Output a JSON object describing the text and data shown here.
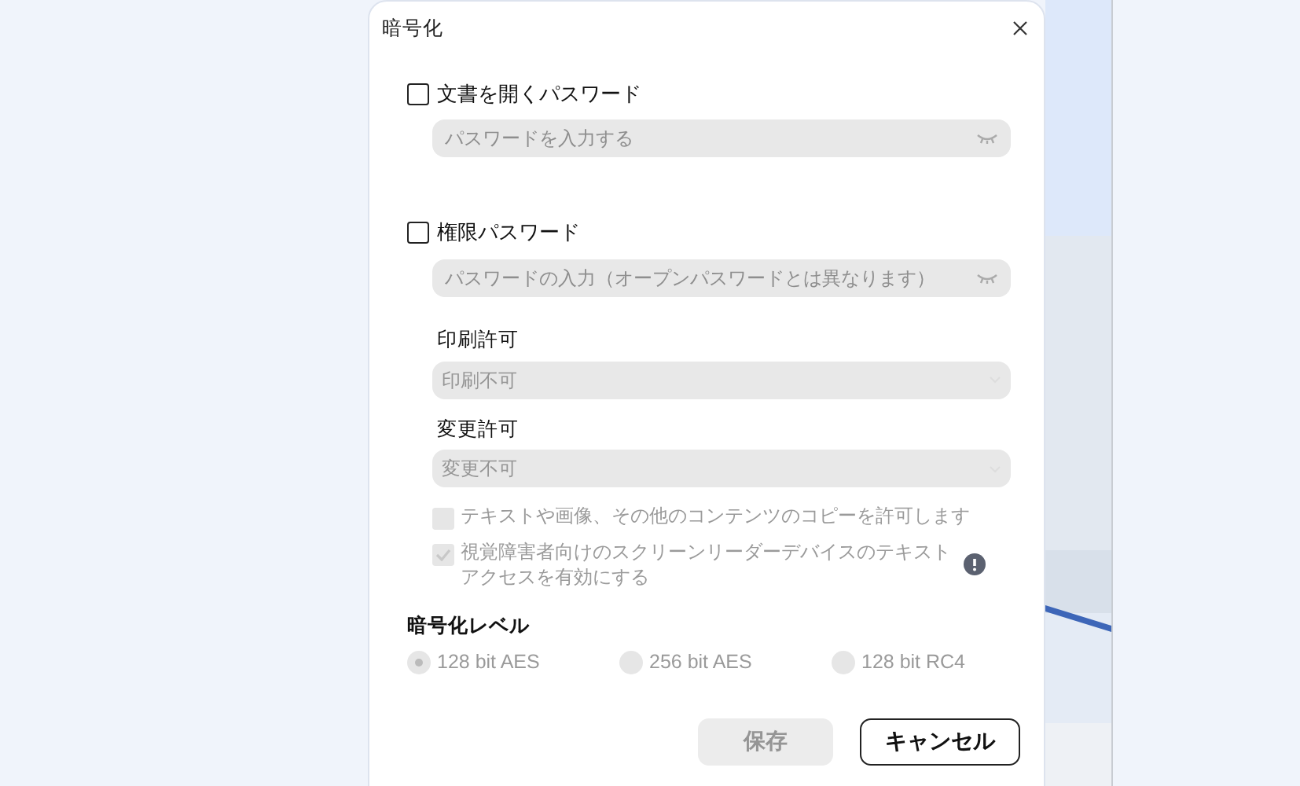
{
  "dialog": {
    "title": "暗号化"
  },
  "open_password": {
    "label": "文書を開くパスワード",
    "checked": false,
    "placeholder": "パスワードを入力する"
  },
  "permission_password": {
    "label": "権限パスワード",
    "checked": false,
    "placeholder": "パスワードの入力（オープンパスワードとは異なります）"
  },
  "print_permission": {
    "label": "印刷許可",
    "value": "印刷不可"
  },
  "change_permission": {
    "label": "変更許可",
    "value": "変更不可"
  },
  "options": [
    {
      "label": "テキストや画像、その他のコンテンツのコピーを許可します",
      "checked": false,
      "info": false
    },
    {
      "label": "視覚障害者向けのスクリーンリーダーデバイスのテキストアクセスを有効にする",
      "checked": true,
      "info": true
    }
  ],
  "encryption_level": {
    "label": "暗号化レベル",
    "options": [
      {
        "label": "128 bit AES",
        "selected": true
      },
      {
        "label": "256 bit AES",
        "selected": false
      },
      {
        "label": "128 bit RC4",
        "selected": false
      }
    ]
  },
  "buttons": [
    {
      "label": "保存",
      "disabled": true
    },
    {
      "label": "キャンセル",
      "disabled": false
    }
  ]
}
